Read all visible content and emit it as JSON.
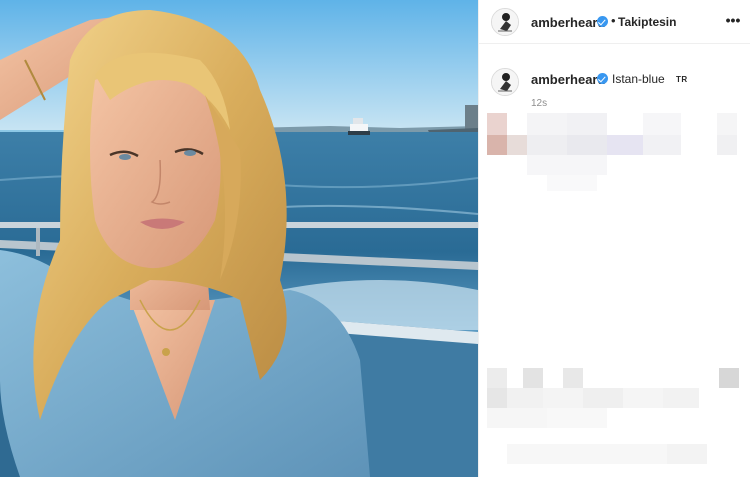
{
  "post": {
    "username": "amberheard",
    "follow_separator": "•",
    "follow_label": "Takiptesin",
    "more_label": "•••",
    "caption_text": "Istan-blue",
    "caption_flag": "TR",
    "time_ago": "12s"
  },
  "colors": {
    "verified_badge": "#3897f0",
    "panel_border": "#efefef",
    "meta_text": "#8e8e8e"
  },
  "icons": {
    "avatar": "avatar-icon",
    "verified": "verified-badge-icon",
    "more": "more-options-icon"
  }
}
